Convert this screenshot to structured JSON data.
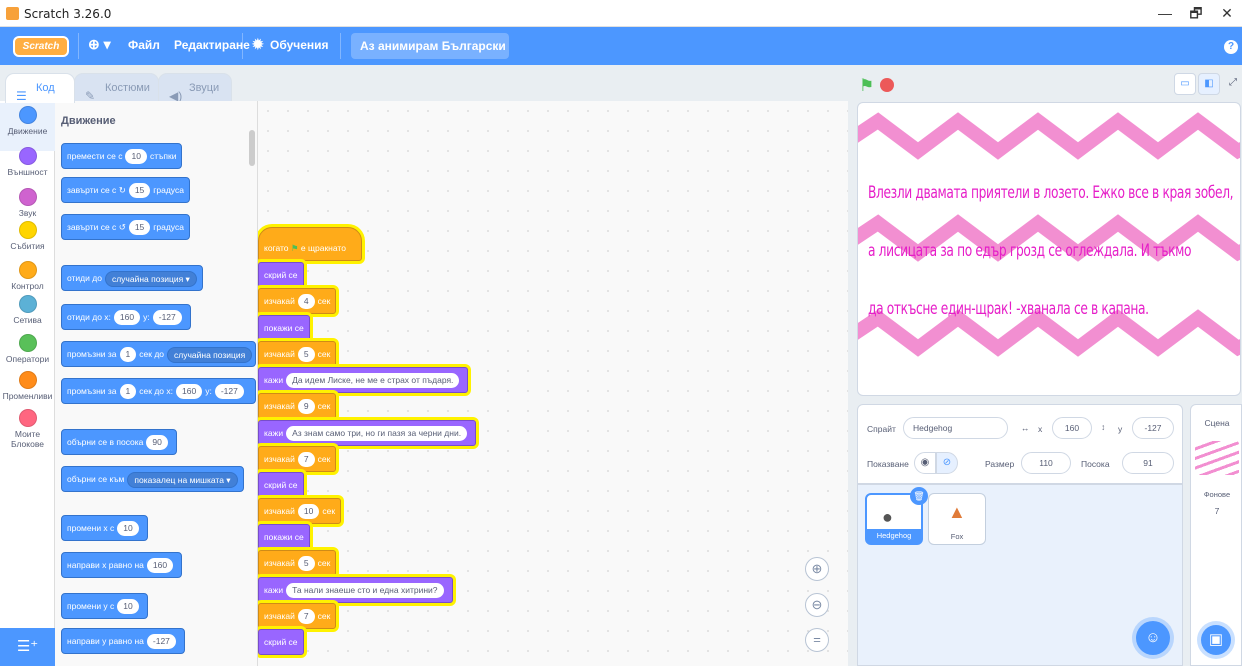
{
  "window": {
    "title": "Scratch 3.26.0",
    "minimize": "—",
    "restore": "🗗",
    "close": "✕"
  },
  "menu": {
    "logo": "Scratch",
    "globe": "⊕ ▾",
    "file": "Файл",
    "edit": "Редактиране",
    "tutorials": "Обучения",
    "project_title": "Аз анимирам Български ...",
    "help": "?"
  },
  "tabs": {
    "code": "Код",
    "costumes": "Костюми",
    "sounds": "Звуци"
  },
  "categories": [
    {
      "label": "Движение",
      "color": "#4c97ff"
    },
    {
      "label": "Външност",
      "color": "#9966ff"
    },
    {
      "label": "Звук",
      "color": "#cf63cf"
    },
    {
      "label": "Събития",
      "color": "#ffd500"
    },
    {
      "label": "Контрол",
      "color": "#ffab19"
    },
    {
      "label": "Сетива",
      "color": "#5cb1d6"
    },
    {
      "label": "Оператори",
      "color": "#59c059"
    },
    {
      "label": "Променливи",
      "color": "#ff8c1a"
    },
    {
      "label": "Моите Блокове",
      "color": "#ff6680"
    }
  ],
  "palette": {
    "title": "Движение",
    "b1": {
      "a": "премести се с",
      "v": "10",
      "b": "стъпки"
    },
    "b2": {
      "a": "завърти се с",
      "icon": "↻",
      "v": "15",
      "b": "градуса"
    },
    "b3": {
      "a": "завърти се с",
      "icon": "↺",
      "v": "15",
      "b": "градуса"
    },
    "b4": {
      "a": "отиди до",
      "dd": "случайна позиция ▾"
    },
    "b5": {
      "a": "отиди до x:",
      "x": "160",
      "b": "y:",
      "y": "-127"
    },
    "b6": {
      "a": "промъзни за",
      "v": "1",
      "b": "сек до",
      "dd": "случайна позиция"
    },
    "b7": {
      "a": "промъзни за",
      "v": "1",
      "b": "сек до x:",
      "x": "160",
      "c": "y:",
      "y": "-127"
    },
    "b8": {
      "a": "обърни се в посока",
      "v": "90"
    },
    "b9": {
      "a": "обърни се към",
      "dd": "показалец на мишката ▾"
    },
    "b10": {
      "a": "промени x с",
      "v": "10"
    },
    "b11": {
      "a": "направи x равно на",
      "v": "160"
    },
    "b12": {
      "a": "промени y с",
      "v": "10"
    },
    "b13": {
      "a": "направи y равно на",
      "v": "-127"
    }
  },
  "script": {
    "hat": {
      "a": "когато",
      "flag": "⚑",
      "b": "е щракнато"
    },
    "s1": "скрий се",
    "s2": {
      "a": "изчакай",
      "v": "4",
      "b": "сек"
    },
    "s3": "покажи се",
    "s4": {
      "a": "изчакай",
      "v": "5",
      "b": "сек"
    },
    "s5": {
      "a": "кажи",
      "v": "Да идем Лиске, не ме е страх от пъдаря."
    },
    "s6": {
      "a": "изчакай",
      "v": "9",
      "b": "сек"
    },
    "s7": {
      "a": "кажи",
      "v": "Аз знам само три, но ги пазя за черни дни."
    },
    "s8": {
      "a": "изчакай",
      "v": "7",
      "b": "сек"
    },
    "s9": "скрий се",
    "s10": {
      "a": "изчакай",
      "v": "10",
      "b": "сек"
    },
    "s11": "покажи се",
    "s12": {
      "a": "изчакай",
      "v": "5",
      "b": "сек"
    },
    "s13": {
      "a": "кажи",
      "v": "Та нали знаеше сто и една хитрини?"
    },
    "s14": {
      "a": "изчакай",
      "v": "7",
      "b": "сек"
    },
    "s15": "скрий се"
  },
  "zoom": {
    "in": "⊕",
    "out": "⊖",
    "reset": "="
  },
  "stage": {
    "text": [
      "Влезли двамата приятели в лозето. Ежко все в края зобел,",
      "а лисицата за по едър грозд се оглеждала. И тъкмо",
      "да откъсне един-щрак! -хванала се в капана."
    ],
    "text_color": "#e61ec8",
    "pattern_color": "#f28fd1"
  },
  "sprite_info": {
    "sprite_label": "Спрайт",
    "sprite_name": "Hedgehog",
    "x_label": "x",
    "x": "160",
    "y_label": "y",
    "y": "-127",
    "show_label": "Показване",
    "size_label": "Размер",
    "size": "110",
    "direction_label": "Посока",
    "direction": "91"
  },
  "sprites": [
    {
      "name": "Hedgehog"
    },
    {
      "name": "Fox"
    }
  ],
  "scene": {
    "title": "Сцена",
    "backdrops_label": "Фонове",
    "backdrops_count": "7"
  }
}
